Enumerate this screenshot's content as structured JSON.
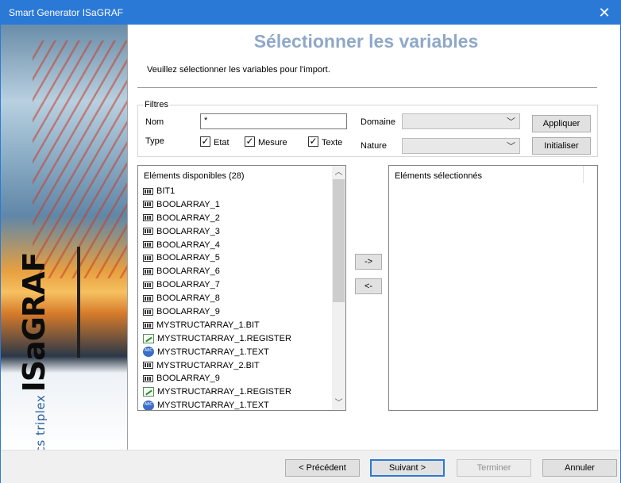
{
  "window": {
    "title": "Smart Generator ISaGRAF",
    "close_glyph": "✕"
  },
  "brand": {
    "ics": "ics triplex",
    "name": "ISaGRAF"
  },
  "header": {
    "title": "Sélectionner les variables",
    "subtitle": "Veuillez sélectionner les variables pour l'import."
  },
  "filters": {
    "legend": "Filtres",
    "name_label": "Nom",
    "name_value": "*",
    "type_label": "Type",
    "types": [
      {
        "label": "Etat",
        "checked": true
      },
      {
        "label": "Mesure",
        "checked": true
      },
      {
        "label": "Texte",
        "checked": true
      }
    ],
    "domain_label": "Domaine",
    "nature_label": "Nature",
    "apply_button": "Appliquer",
    "reset_button": "Initialiser"
  },
  "available": {
    "header": "Eléments disponibles (28)",
    "items": [
      {
        "icon": "bool-icon",
        "label": "BIT1"
      },
      {
        "icon": "bool-icon",
        "label": "BOOLARRAY_1"
      },
      {
        "icon": "bool-icon",
        "label": "BOOLARRAY_2"
      },
      {
        "icon": "bool-icon",
        "label": "BOOLARRAY_3"
      },
      {
        "icon": "bool-icon",
        "label": "BOOLARRAY_4"
      },
      {
        "icon": "bool-icon",
        "label": "BOOLARRAY_5"
      },
      {
        "icon": "bool-icon",
        "label": "BOOLARRAY_6"
      },
      {
        "icon": "bool-icon",
        "label": "BOOLARRAY_7"
      },
      {
        "icon": "bool-icon",
        "label": "BOOLARRAY_8"
      },
      {
        "icon": "bool-icon",
        "label": "BOOLARRAY_9"
      },
      {
        "icon": "bool-icon",
        "label": "MYSTRUCTARRAY_1.BIT"
      },
      {
        "icon": "register-icon",
        "label": "MYSTRUCTARRAY_1.REGISTER"
      },
      {
        "icon": "text-icon",
        "label": "MYSTRUCTARRAY_1.TEXT"
      },
      {
        "icon": "bool-icon",
        "label": "MYSTRUCTARRAY_2.BIT"
      },
      {
        "icon": "bool-icon",
        "label": "BOOLARRAY_9"
      },
      {
        "icon": "register-icon",
        "label": "MYSTRUCTARRAY_1.REGISTER"
      },
      {
        "icon": "text-icon",
        "label": "MYSTRUCTARRAY_1.TEXT"
      }
    ]
  },
  "transfer": {
    "add": "->",
    "remove": "<-"
  },
  "selected": {
    "header": "Eléments sélectionnés"
  },
  "footer": {
    "previous": "< Précédent",
    "next": "Suivant >",
    "finish": "Terminer",
    "cancel": "Annuler"
  },
  "colors": {
    "titlebar": "#2b79d6",
    "heading": "#8fa8c8"
  }
}
